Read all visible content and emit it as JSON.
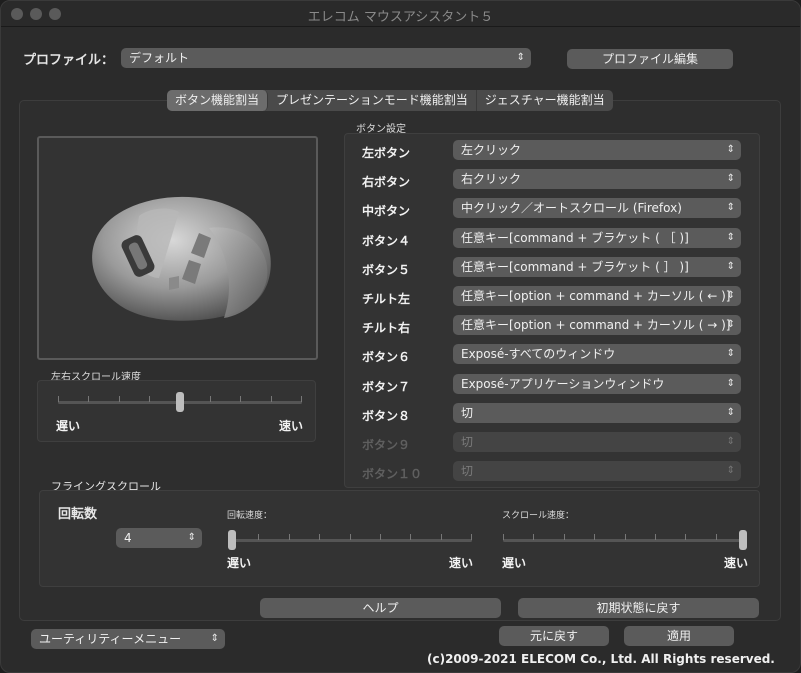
{
  "window": {
    "title": "エレコム マウスアシスタント５"
  },
  "profile": {
    "label": "プロファイル：",
    "value": "デフォルト",
    "edit_button": "プロファイル編集"
  },
  "tabs": [
    {
      "label": "ボタン機能割当",
      "active": true
    },
    {
      "label": "プレゼンテーションモード機能割当",
      "active": false
    },
    {
      "label": "ジェスチャー機能割当",
      "active": false
    }
  ],
  "button_settings": {
    "group_label": "ボタン設定",
    "rows": [
      {
        "label": "左ボタン",
        "value": "左クリック",
        "enabled": true
      },
      {
        "label": "右ボタン",
        "value": "右クリック",
        "enabled": true
      },
      {
        "label": "中ボタン",
        "value": "中クリック／オートスクロール (Firefox)",
        "enabled": true
      },
      {
        "label": "ボタン４",
        "value": "任意キー[command + ブラケット ( ［ )]",
        "enabled": true
      },
      {
        "label": "ボタン５",
        "value": "任意キー[command + ブラケット ( ］ )]",
        "enabled": true
      },
      {
        "label": "チルト左",
        "value": "任意キー[option + command + カーソル ( ← )]",
        "enabled": true
      },
      {
        "label": "チルト右",
        "value": "任意キー[option + command + カーソル ( → )]",
        "enabled": true
      },
      {
        "label": "ボタン６",
        "value": "Exposé-すべてのウィンドウ",
        "enabled": true
      },
      {
        "label": "ボタン７",
        "value": "Exposé-アプリケーションウィンドウ",
        "enabled": true
      },
      {
        "label": "ボタン８",
        "value": "切",
        "enabled": true
      },
      {
        "label": "ボタン９",
        "value": "切",
        "enabled": false
      },
      {
        "label": "ボタン１０",
        "value": "切",
        "enabled": false
      }
    ]
  },
  "horizontal_scroll": {
    "label": "左右スクロール速度",
    "slow": "遅い",
    "fast": "速い",
    "value": 0.5
  },
  "flying_scroll": {
    "label": "フライングスクロール",
    "rotations_label": "回転数",
    "rotations_value": "4",
    "rotation_speed": {
      "label": "回転速度：",
      "slow": "遅い",
      "fast": "速い",
      "value": 0.0
    },
    "scroll_speed": {
      "label": "スクロール速度：",
      "slow": "遅い",
      "fast": "速い",
      "value": 1.0
    }
  },
  "actions": {
    "help": "ヘルプ",
    "reset_defaults": "初期状態に戻す",
    "revert": "元に戻す",
    "apply": "適用"
  },
  "utility_menu": {
    "value": "ユーティリティーメニュー"
  },
  "copyright": "(c)2009-2021 ELECOM Co., Ltd. All Rights reserved."
}
